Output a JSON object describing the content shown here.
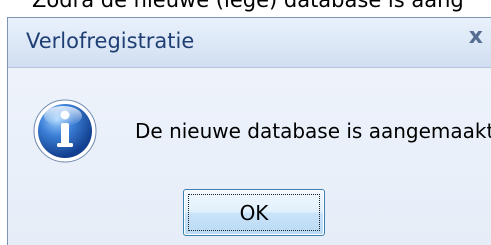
{
  "background": {
    "partial_text": "Zodra de nieuwe (lege) database is aang"
  },
  "dialog": {
    "title": "Verlofregistratie",
    "close_label": "x",
    "message": "De nieuwe database is aangemaakt.",
    "ok_label": "OK",
    "icon": "information-icon"
  },
  "colors": {
    "title_text": "#1f3f74",
    "dialog_background": "#e4ecf7",
    "button_border": "#3c7fb1",
    "icon_blue": "#1b58b8"
  }
}
